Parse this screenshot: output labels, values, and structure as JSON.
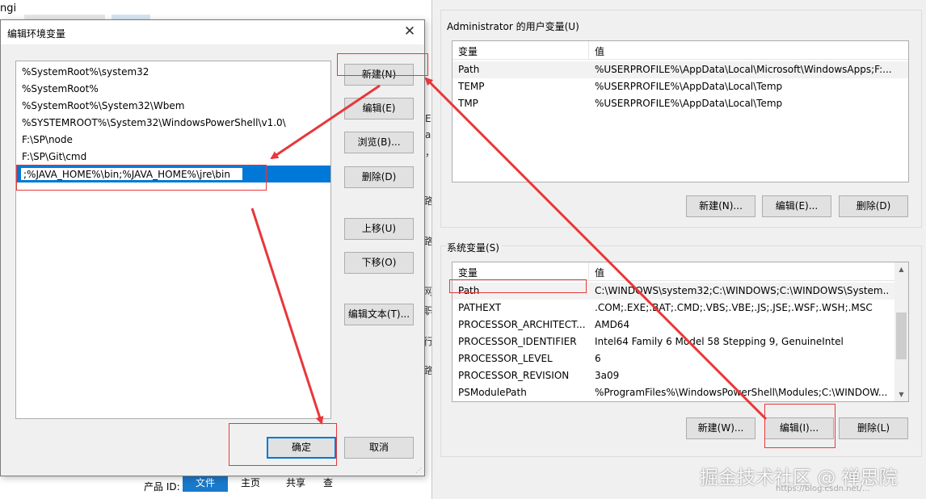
{
  "background_window": {
    "user_vars_label": "Administrator 的用户变量(U)",
    "user_vars_headers": [
      "变量",
      "值"
    ],
    "user_vars": [
      {
        "name": "Path",
        "value": "%USERPROFILE%\\AppData\\Local\\Microsoft\\WindowsApps;F:..."
      },
      {
        "name": "TEMP",
        "value": "%USERPROFILE%\\AppData\\Local\\Temp"
      },
      {
        "name": "TMP",
        "value": "%USERPROFILE%\\AppData\\Local\\Temp"
      }
    ],
    "user_buttons": {
      "new": "新建(N)...",
      "edit": "编辑(E)...",
      "delete": "删除(D)"
    },
    "system_vars_label": "系统变量(S)",
    "system_vars_headers": [
      "变量",
      "值"
    ],
    "system_vars": [
      {
        "name": "Path",
        "value": "C:\\WINDOWS\\system32;C:\\WINDOWS;C:\\WINDOWS\\System..."
      },
      {
        "name": "PATHEXT",
        "value": ".COM;.EXE;.BAT;.CMD;.VBS;.VBE;.JS;.JSE;.WSF;.WSH;.MSC"
      },
      {
        "name": "PROCESSOR_ARCHITECT...",
        "value": "AMD64"
      },
      {
        "name": "PROCESSOR_IDENTIFIER",
        "value": "Intel64 Family 6 Model 58 Stepping 9, GenuineIntel"
      },
      {
        "name": "PROCESSOR_LEVEL",
        "value": "6"
      },
      {
        "name": "PROCESSOR_REVISION",
        "value": "3a09"
      },
      {
        "name": "PSModulePath",
        "value": "%ProgramFiles%\\WindowsPowerShell\\Modules;C:\\WINDOW..."
      }
    ],
    "system_buttons": {
      "new": "新建(W)...",
      "edit": "编辑(I)...",
      "delete": "删除(L)"
    }
  },
  "left_background": {
    "top_fragment": "ngi",
    "side_chars": [
      "E",
      "a",
      "，",
      "路",
      "路",
      "网",
      "职",
      "行",
      "路"
    ],
    "bottom_label": "产品 ID:",
    "ribbon_tabs": [
      "文件",
      "主页",
      "共享",
      "查"
    ]
  },
  "dialog": {
    "title": "编辑环境变量",
    "close_symbol": "✕",
    "paths": [
      "%SystemRoot%\\system32",
      "%SystemRoot%",
      "%SystemRoot%\\System32\\Wbem",
      "%SYSTEMROOT%\\System32\\WindowsPowerShell\\v1.0\\",
      "F:\\SP\\node",
      "F:\\SP\\Git\\cmd"
    ],
    "editing_value": ";%JAVA_HOME%\\bin;%JAVA_HOME%\\jre\\bin",
    "buttons": {
      "new": "新建(N)",
      "edit": "编辑(E)",
      "browse": "浏览(B)...",
      "delete": "删除(D)",
      "move_up": "上移(U)",
      "move_down": "下移(O)",
      "edit_text": "编辑文本(T)...",
      "ok": "确定",
      "cancel": "取消"
    }
  },
  "watermark": {
    "main": "掘金技术社区 @ 禅思院",
    "sub": "https://blog.csdn.net/..."
  },
  "colors": {
    "annotation": "#e8373a",
    "selection": "#0078d7"
  }
}
